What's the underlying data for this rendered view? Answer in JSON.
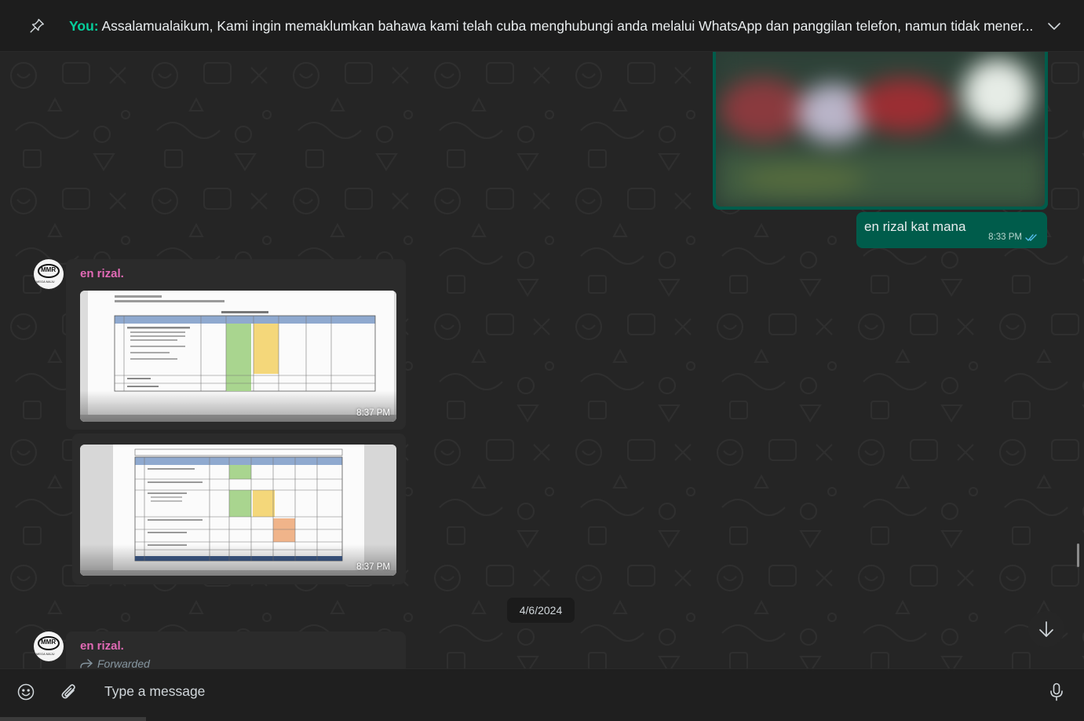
{
  "pinned": {
    "sender": "You:",
    "text": "Assalamualaikum,  Kami ingin memaklumkan bahawa kami telah cuba menghubungi anda melalui WhatsApp dan panggilan telefon, namun tidak mener..."
  },
  "messages": {
    "outgoing_text": "en rizal kat mana",
    "outgoing_time": "8:33 PM",
    "incoming_1": {
      "sender": "en rizal.",
      "image_1_time": "8:37 PM",
      "image_2_time": "8:37 PM"
    },
    "date_chip": "4/6/2024",
    "incoming_2": {
      "sender": "en rizal.",
      "forwarded_label": "Forwarded"
    }
  },
  "composer": {
    "placeholder": "Type a message"
  },
  "colors": {
    "outgoing_bubble": "#005c4b",
    "incoming_bubble": "#2b2b2b",
    "sender_name": "#e26ab6",
    "pinned_sender": "#06cf9c",
    "read_ticks": "#53bdeb"
  },
  "icons": [
    "pin-icon",
    "chevron-down-icon",
    "double-check-icon",
    "forward-icon",
    "arrow-down-icon",
    "emoji-icon",
    "paperclip-icon",
    "microphone-icon"
  ]
}
